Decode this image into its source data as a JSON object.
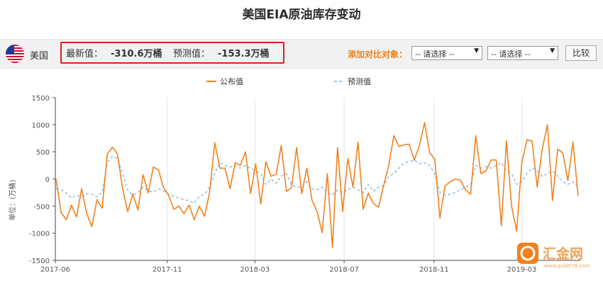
{
  "title": "美国EIA原油库存变动",
  "header": {
    "country": "美国",
    "latest_label": "最新值：",
    "latest_value": "-310.6万桶",
    "forecast_label": "预测值：",
    "forecast_value": "-153.3万桶",
    "compare_label": "添加对比对象：",
    "select1": "-- 请选择 --",
    "select2": "-- 请选择 --",
    "compare_button": "比较"
  },
  "watermark": {
    "name": "汇金网",
    "url": "www.gold678.com"
  },
  "colors": {
    "published": "#f0821e",
    "forecast": "#9cc3e6",
    "accent": "#e8821a",
    "highlight": "#e02020"
  },
  "chart_data": {
    "type": "line",
    "legend": [
      "公布值",
      "预测值"
    ],
    "legend_position": "top-center",
    "ylabel": "单位：(万桶)",
    "ylim": [
      -1500,
      1500
    ],
    "yticks": [
      1500,
      1000,
      500,
      0,
      -500,
      -1000,
      -1500
    ],
    "xlim": [
      "2017-06-01",
      "2019-05-20"
    ],
    "xticks": [
      "2017-06",
      "2017-11",
      "2018-03",
      "2018-07",
      "2018-11",
      "2019-03"
    ],
    "grid": "vertical",
    "published": [
      [
        "2017-06-02",
        0
      ],
      [
        "2017-06-09",
        -620
      ],
      [
        "2017-06-16",
        -750
      ],
      [
        "2017-06-23",
        -480
      ],
      [
        "2017-06-30",
        -700
      ],
      [
        "2017-07-07",
        -180
      ],
      [
        "2017-07-14",
        -640
      ],
      [
        "2017-07-21",
        -880
      ],
      [
        "2017-07-28",
        -380
      ],
      [
        "2017-08-04",
        -540
      ],
      [
        "2017-08-11",
        460
      ],
      [
        "2017-08-18",
        590
      ],
      [
        "2017-08-25",
        460
      ],
      [
        "2017-09-01",
        -180
      ],
      [
        "2017-09-08",
        -600
      ],
      [
        "2017-09-15",
        -280
      ],
      [
        "2017-09-22",
        -570
      ],
      [
        "2017-09-29",
        80
      ],
      [
        "2017-10-06",
        -260
      ],
      [
        "2017-10-13",
        220
      ],
      [
        "2017-10-20",
        170
      ],
      [
        "2017-10-27",
        -160
      ],
      [
        "2017-11-03",
        -300
      ],
      [
        "2017-11-10",
        -560
      ],
      [
        "2017-11-17",
        -500
      ],
      [
        "2017-11-24",
        -640
      ],
      [
        "2017-12-01",
        -480
      ],
      [
        "2017-12-08",
        -750
      ],
      [
        "2017-12-15",
        -500
      ],
      [
        "2017-12-22",
        -690
      ],
      [
        "2017-12-29",
        -240
      ],
      [
        "2018-01-05",
        670
      ],
      [
        "2018-01-12",
        200
      ],
      [
        "2018-01-19",
        200
      ],
      [
        "2018-01-26",
        -180
      ],
      [
        "2018-02-02",
        300
      ],
      [
        "2018-02-09",
        250
      ],
      [
        "2018-02-16",
        500
      ],
      [
        "2018-02-23",
        -270
      ],
      [
        "2018-03-02",
        280
      ],
      [
        "2018-03-09",
        -460
      ],
      [
        "2018-03-16",
        320
      ],
      [
        "2018-03-23",
        50
      ],
      [
        "2018-03-30",
        90
      ],
      [
        "2018-04-06",
        620
      ],
      [
        "2018-04-13",
        -230
      ],
      [
        "2018-04-20",
        -160
      ],
      [
        "2018-04-27",
        580
      ],
      [
        "2018-05-04",
        -270
      ],
      [
        "2018-05-11",
        200
      ],
      [
        "2018-05-18",
        -390
      ],
      [
        "2018-05-25",
        -600
      ],
      [
        "2018-06-01",
        -990
      ],
      [
        "2018-06-08",
        100
      ],
      [
        "2018-06-15",
        -1260
      ],
      [
        "2018-06-22",
        580
      ],
      [
        "2018-06-29",
        -600
      ],
      [
        "2018-07-06",
        380
      ],
      [
        "2018-07-13",
        -150
      ],
      [
        "2018-07-20",
        680
      ],
      [
        "2018-07-27",
        -560
      ],
      [
        "2018-08-03",
        -260
      ],
      [
        "2018-08-10",
        -450
      ],
      [
        "2018-08-17",
        -520
      ],
      [
        "2018-08-24",
        -120
      ],
      [
        "2018-08-31",
        250
      ],
      [
        "2018-09-07",
        800
      ],
      [
        "2018-09-14",
        600
      ],
      [
        "2018-09-21",
        630
      ],
      [
        "2018-09-28",
        640
      ],
      [
        "2018-10-05",
        350
      ],
      [
        "2018-10-12",
        620
      ],
      [
        "2018-10-19",
        1040
      ],
      [
        "2018-10-26",
        480
      ],
      [
        "2018-11-02",
        370
      ],
      [
        "2018-11-09",
        -720
      ],
      [
        "2018-11-16",
        -130
      ],
      [
        "2018-11-23",
        -50
      ],
      [
        "2018-11-30",
        0
      ],
      [
        "2018-12-07",
        -20
      ],
      [
        "2018-12-14",
        -200
      ],
      [
        "2018-12-21",
        -280
      ],
      [
        "2018-12-28",
        800
      ],
      [
        "2019-01-04",
        100
      ],
      [
        "2019-01-11",
        150
      ],
      [
        "2019-01-18",
        350
      ],
      [
        "2019-01-25",
        350
      ],
      [
        "2019-02-01",
        -860
      ],
      [
        "2019-02-08",
        700
      ],
      [
        "2019-02-15",
        -500
      ],
      [
        "2019-02-22",
        -960
      ],
      [
        "2019-03-01",
        300
      ],
      [
        "2019-03-08",
        720
      ],
      [
        "2019-03-15",
        700
      ],
      [
        "2019-03-22",
        -150
      ],
      [
        "2019-03-29",
        550
      ],
      [
        "2019-04-05",
        1000
      ],
      [
        "2019-04-12",
        -400
      ],
      [
        "2019-04-19",
        550
      ],
      [
        "2019-04-26",
        480
      ],
      [
        "2019-05-03",
        -30
      ],
      [
        "2019-05-10",
        680
      ],
      [
        "2019-05-17",
        -310.6
      ]
    ],
    "forecast": [
      [
        "2017-06-02",
        -180
      ],
      [
        "2017-06-09",
        -200
      ],
      [
        "2017-06-16",
        -260
      ],
      [
        "2017-06-23",
        -350
      ],
      [
        "2017-06-30",
        -300
      ],
      [
        "2017-07-07",
        -330
      ],
      [
        "2017-07-14",
        -270
      ],
      [
        "2017-07-21",
        -280
      ],
      [
        "2017-07-28",
        -330
      ],
      [
        "2017-08-04",
        -250
      ],
      [
        "2017-08-11",
        300
      ],
      [
        "2017-08-18",
        420
      ],
      [
        "2017-08-25",
        380
      ],
      [
        "2017-09-01",
        100
      ],
      [
        "2017-09-08",
        -200
      ],
      [
        "2017-09-15",
        -300
      ],
      [
        "2017-09-22",
        -250
      ],
      [
        "2017-09-29",
        -150
      ],
      [
        "2017-10-06",
        -220
      ],
      [
        "2017-10-13",
        -240
      ],
      [
        "2017-10-20",
        -180
      ],
      [
        "2017-10-27",
        -220
      ],
      [
        "2017-11-03",
        -280
      ],
      [
        "2017-11-10",
        -320
      ],
      [
        "2017-11-17",
        -350
      ],
      [
        "2017-11-24",
        -380
      ],
      [
        "2017-12-01",
        -400
      ],
      [
        "2017-12-08",
        -450
      ],
      [
        "2017-12-15",
        -320
      ],
      [
        "2017-12-22",
        -280
      ],
      [
        "2017-12-29",
        -150
      ],
      [
        "2018-01-05",
        100
      ],
      [
        "2018-01-12",
        300
      ],
      [
        "2018-01-19",
        250
      ],
      [
        "2018-01-26",
        220
      ],
      [
        "2018-02-02",
        240
      ],
      [
        "2018-02-09",
        200
      ],
      [
        "2018-02-16",
        250
      ],
      [
        "2018-02-23",
        200
      ],
      [
        "2018-03-02",
        150
      ],
      [
        "2018-03-09",
        100
      ],
      [
        "2018-03-16",
        -100
      ],
      [
        "2018-03-23",
        0
      ],
      [
        "2018-03-30",
        -80
      ],
      [
        "2018-04-06",
        50
      ],
      [
        "2018-04-13",
        100
      ],
      [
        "2018-04-20",
        -100
      ],
      [
        "2018-04-27",
        -150
      ],
      [
        "2018-05-04",
        -150
      ],
      [
        "2018-05-11",
        -50
      ],
      [
        "2018-05-18",
        -180
      ],
      [
        "2018-05-25",
        -200
      ],
      [
        "2018-06-01",
        -150
      ],
      [
        "2018-06-08",
        -250
      ],
      [
        "2018-06-15",
        -300
      ],
      [
        "2018-06-22",
        -200
      ],
      [
        "2018-06-29",
        -250
      ],
      [
        "2018-07-06",
        -200
      ],
      [
        "2018-07-13",
        -150
      ],
      [
        "2018-07-20",
        -200
      ],
      [
        "2018-07-27",
        -250
      ],
      [
        "2018-08-03",
        -100
      ],
      [
        "2018-08-10",
        -230
      ],
      [
        "2018-08-17",
        -150
      ],
      [
        "2018-08-24",
        -120
      ],
      [
        "2018-08-31",
        50
      ],
      [
        "2018-09-07",
        100
      ],
      [
        "2018-09-14",
        200
      ],
      [
        "2018-09-21",
        300
      ],
      [
        "2018-09-28",
        320
      ],
      [
        "2018-10-05",
        350
      ],
      [
        "2018-10-12",
        280
      ],
      [
        "2018-10-19",
        300
      ],
      [
        "2018-10-26",
        250
      ],
      [
        "2018-11-02",
        100
      ],
      [
        "2018-11-09",
        -250
      ],
      [
        "2018-11-16",
        -300
      ],
      [
        "2018-11-23",
        -280
      ],
      [
        "2018-11-30",
        -250
      ],
      [
        "2018-12-07",
        -200
      ],
      [
        "2018-12-14",
        -150
      ],
      [
        "2018-12-21",
        -100
      ],
      [
        "2018-12-28",
        250
      ],
      [
        "2019-01-04",
        200
      ],
      [
        "2019-01-11",
        230
      ],
      [
        "2019-01-18",
        200
      ],
      [
        "2019-01-25",
        250
      ],
      [
        "2019-02-01",
        300
      ],
      [
        "2019-02-08",
        150
      ],
      [
        "2019-02-15",
        100
      ],
      [
        "2019-02-22",
        -100
      ],
      [
        "2019-03-01",
        -50
      ],
      [
        "2019-03-08",
        100
      ],
      [
        "2019-03-15",
        200
      ],
      [
        "2019-03-22",
        150
      ],
      [
        "2019-03-29",
        50
      ],
      [
        "2019-04-05",
        100
      ],
      [
        "2019-04-12",
        150
      ],
      [
        "2019-04-19",
        50
      ],
      [
        "2019-04-26",
        -50
      ],
      [
        "2019-05-03",
        -100
      ],
      [
        "2019-05-10",
        -50
      ],
      [
        "2019-05-17",
        -153.3
      ]
    ]
  }
}
